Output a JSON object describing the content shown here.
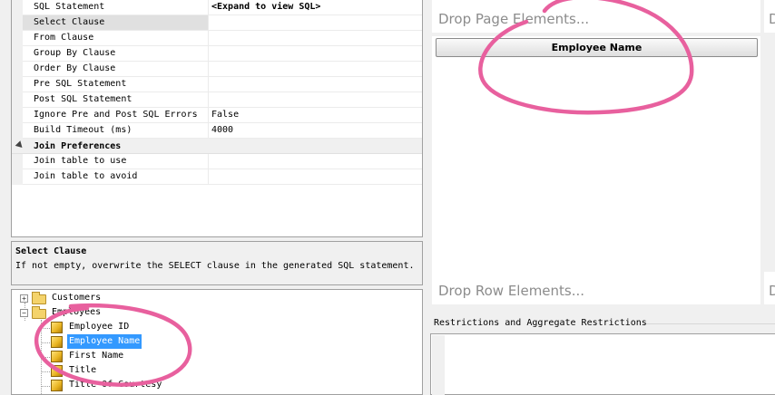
{
  "properties": {
    "rows": [
      {
        "name": "SQL Statement",
        "value": "<Expand to view SQL>"
      },
      {
        "name": "Select Clause",
        "value": ""
      },
      {
        "name": "From Clause",
        "value": ""
      },
      {
        "name": "Group By Clause",
        "value": ""
      },
      {
        "name": "Order By Clause",
        "value": ""
      },
      {
        "name": "Pre SQL Statement",
        "value": ""
      },
      {
        "name": "Post SQL Statement",
        "value": ""
      },
      {
        "name": "Ignore Pre and Post SQL Errors",
        "value": "False"
      },
      {
        "name": "Build Timeout (ms)",
        "value": "4000"
      }
    ],
    "category": "Join Preferences",
    "join_rows": [
      {
        "name": "Join table to use",
        "value": ""
      },
      {
        "name": "Join table to avoid",
        "value": ""
      }
    ]
  },
  "description": {
    "title": "Select Clause",
    "text": "If not empty, overwrite the SELECT clause in the generated SQL statement."
  },
  "tree": {
    "folders": [
      "Customers",
      "Employees"
    ],
    "fields": [
      "Employee ID",
      "Employee Name",
      "First Name",
      "Title",
      "Title Of Courtesy"
    ]
  },
  "pivot": {
    "page_drop": "Drop Page Elements...",
    "row_drop": "Drop Row Elements...",
    "column_field": "Employee Name",
    "right_glyph": "D",
    "restrictions_header": "Restrictions and Aggregate Restrictions"
  },
  "colors": {
    "annotation": "#e8609e",
    "highlight": "#3399ff"
  }
}
